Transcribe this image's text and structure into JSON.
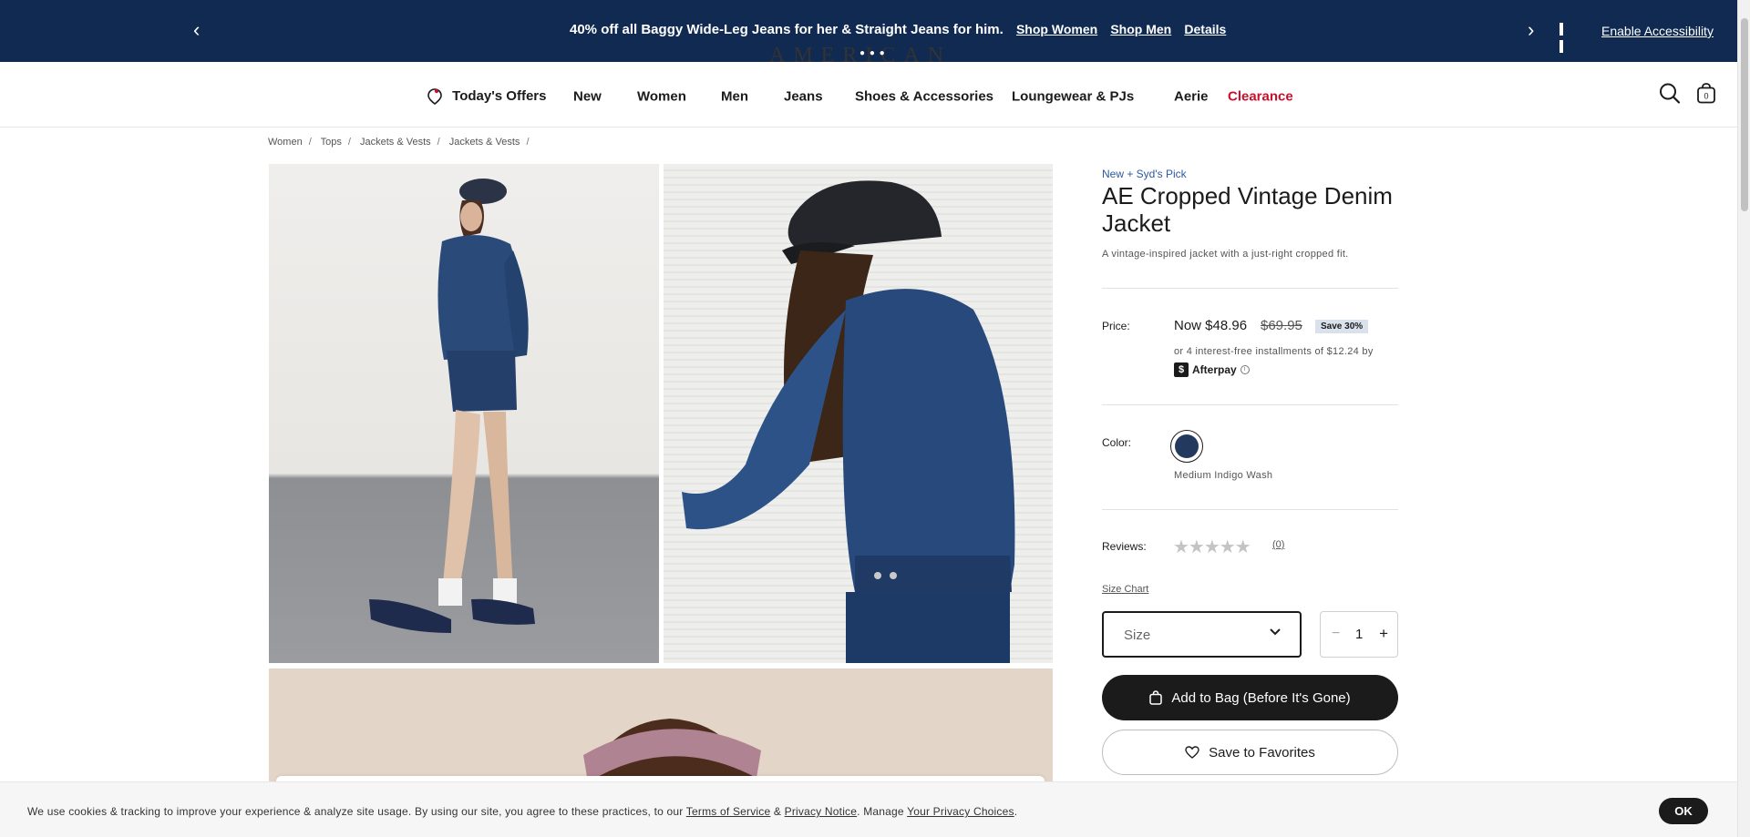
{
  "promo": {
    "message": "40% off all Baggy Wide-Leg Jeans for her & Straight Jeans for him.",
    "shop_women": "Shop Women",
    "shop_men": "Shop Men",
    "details": "Details",
    "prev_arrow": "‹",
    "next_arrow": "›",
    "accessibility": "Enable Accessibility",
    "background_color": "#102a52"
  },
  "logo": {
    "text": "AMERICAN EAGLE"
  },
  "nav": {
    "items": [
      {
        "label": "Today's Offers",
        "icon": "tag-icon"
      },
      {
        "label": "New"
      },
      {
        "label": "Women"
      },
      {
        "label": "Men"
      },
      {
        "label": "Jeans"
      },
      {
        "label": "Shoes & Accessories"
      },
      {
        "label": "Loungewear & PJs"
      },
      {
        "label": "Aerie"
      },
      {
        "label": "Clearance",
        "color": "#c8102e"
      }
    ],
    "bag_count": "0"
  },
  "breadcrumb": [
    "Women",
    "Tops",
    "Jackets & Vests",
    "Jackets & Vests"
  ],
  "product": {
    "tagline": "New + Syd's Pick",
    "title": "AE Cropped Vintage Denim Jacket",
    "description": "A vintage-inspired jacket with a just-right cropped fit.",
    "price_label": "Price:",
    "price_now": "Now $48.96",
    "price_was": "$69.95",
    "save_badge": "Save 30%",
    "installments": "or 4 interest-free installments of $12.24 by",
    "afterpay": "Afterpay",
    "color_label": "Color:",
    "color_name": "Medium Indigo Wash",
    "swatch_color": "#23395d",
    "reviews_label": "Reviews:",
    "review_count": "(0)",
    "rating_stars_filled": 0,
    "size_chart": "Size Chart",
    "size_placeholder": "Size",
    "quantity": "1",
    "add_to_bag": "Add to Bag (Before It's Gone)",
    "save_favorites": "Save to Favorites"
  },
  "cookie": {
    "text_before": "We use cookies & tracking to improve your experience & analyze site usage. By using our site, you agree to these practices, to our ",
    "terms": "Terms of Service",
    "amp": " & ",
    "privacy": "Privacy Notice",
    "manage": ". Manage ",
    "choices": "Your Privacy Choices",
    "end": ".",
    "ok": "OK"
  }
}
